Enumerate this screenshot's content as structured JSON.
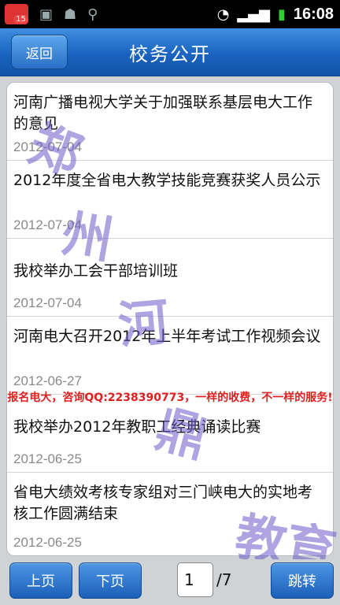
{
  "status": {
    "time": "16:08",
    "badge": "15"
  },
  "header": {
    "back_label": "返回",
    "title": "校务公开"
  },
  "items": [
    {
      "title": "河南广播电视大学关于加强联系基层电大工作的意见",
      "date": "2012-07-04"
    },
    {
      "title": "2012年度全省电大教学技能竞赛获奖人员公示",
      "date": "2012-07-04"
    },
    {
      "title": "我校举办工会干部培训班",
      "date": "2012-07-04"
    },
    {
      "title": "河南电大召开2012年上半年考试工作视频会议",
      "date": "2012-06-27"
    },
    {
      "title": "我校举办2012年教职工经典诵读比赛",
      "date": "2012-06-25"
    },
    {
      "title": "省电大绩效考核专家组对三门峡电大的实地考核工作圆满结束",
      "date": "2012-06-25"
    }
  ],
  "watermark": {
    "chars": [
      "郑",
      "州",
      "河",
      "鼎",
      "教育"
    ],
    "banner": "报名电大，咨询QQ:2238390773，一样的收费，不一样的服务!"
  },
  "pager": {
    "prev_label": "上页",
    "next_label": "下页",
    "current_page": "1",
    "total_pages": "/7",
    "jump_label": "跳转"
  }
}
